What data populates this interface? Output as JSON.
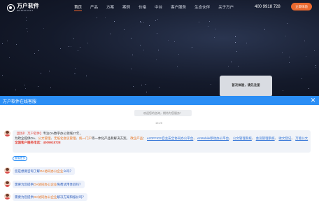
{
  "header": {
    "logo_name": "万户软件",
    "logo_sub": "WANHUSOFT",
    "nav": [
      "首页",
      "产品",
      "方案",
      "案例",
      "价格",
      "中台",
      "客户服务",
      "生态伙伴",
      "关于万户"
    ],
    "phone": "400 9918 728",
    "trial_label": "立即体验"
  },
  "promo": {
    "text": "首次体验，请先注册"
  },
  "chat": {
    "title": "万户软件在线客服",
    "notice": "欢迎您的咨询，期待为您服务！",
    "timestamp": "15:25",
    "main_message": {
      "intro_tag": "【您好！万户软件】",
      "intro": "专注OA数字办公领域27年，",
      "line2_pre": "为政企提供OA、",
      "p1": "公文管理",
      "sep1": "、",
      "p2": "无纸化会议管理",
      "sep2": "、",
      "p3": "统一门户",
      "line2_mid": "等一体化产品和解决方案。",
      "p4": "政企产品",
      "colon": "：",
      "links": [
        "ezOFFICE自主安全协同办公平台",
        "ezMobile移动办公平台",
        "公文管理系统",
        "会议管理系统",
        "收文登记",
        "万能公文"
      ],
      "hotline": "全国客户服务电话：4009918728"
    },
    "more_label": "查看更多",
    "questions": [
      {
        "pre": "您是想要咨询了解",
        "hl": "OA协同办公企业",
        "post": "么吗？"
      },
      {
        "pre": "需要为您提供",
        "hl": "OA协同办公企业",
        "post": "免费试用体验吗？"
      },
      {
        "pre": "需要为您提供",
        "hl": "OA协同办公企业",
        "post": "解决方案和报价吗？"
      }
    ]
  },
  "colors": {
    "accent": "#2b8ef5",
    "orange": "#e9692f",
    "highlight_red": "#e23b2e"
  }
}
